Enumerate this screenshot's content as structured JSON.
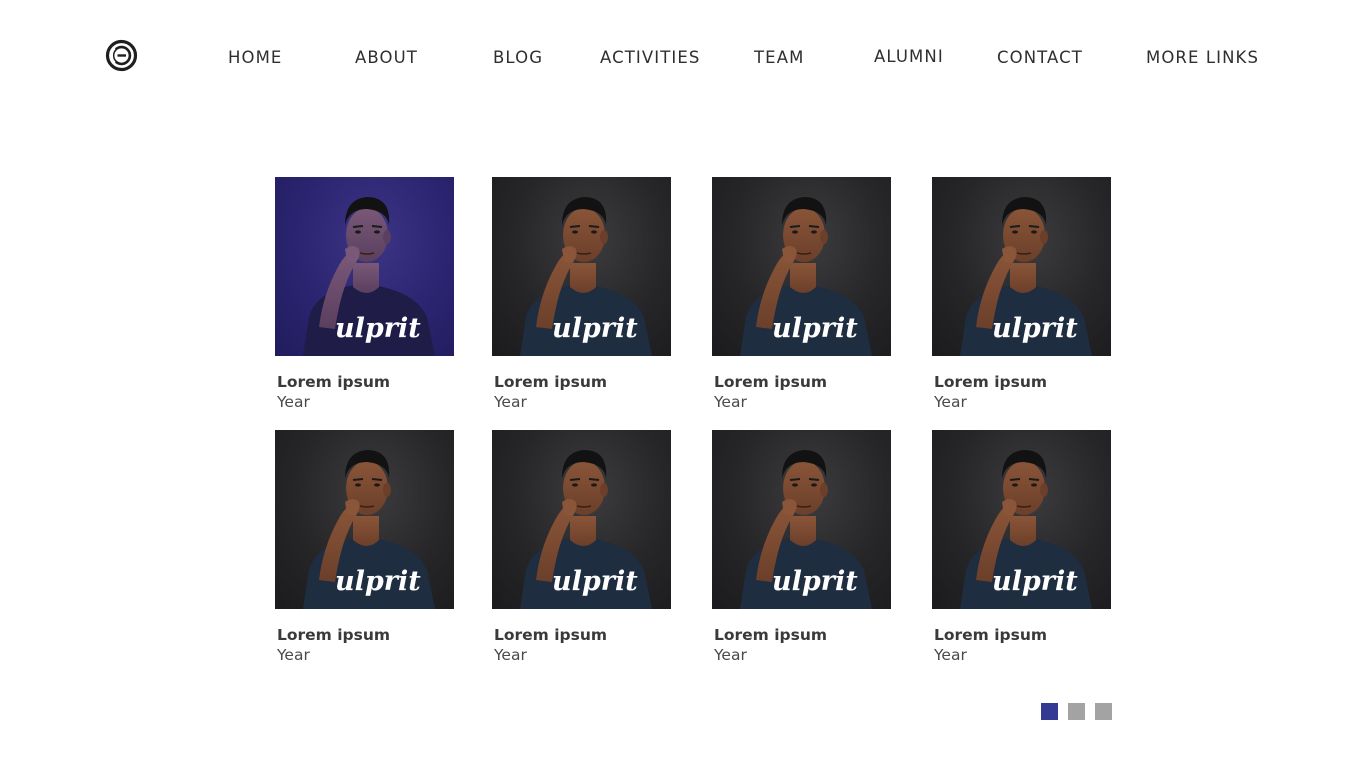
{
  "nav": {
    "logo_icon": "circle-logo-icon",
    "items": [
      {
        "label": "HOME"
      },
      {
        "label": "ABOUT"
      },
      {
        "label": "BLOG"
      },
      {
        "label": "ACTIVITIES"
      },
      {
        "label": "TEAM"
      },
      {
        "label": "ALUMNI"
      },
      {
        "label": "CONTACT"
      },
      {
        "label": "MORE LINKS"
      }
    ]
  },
  "team": {
    "members": [
      {
        "name": "Lorem ipsum",
        "year": "Year",
        "shirt_text": "ulprit",
        "highlighted": true
      },
      {
        "name": "Lorem ipsum",
        "year": "Year",
        "shirt_text": "ulprit",
        "highlighted": false
      },
      {
        "name": "Lorem ipsum",
        "year": "Year",
        "shirt_text": "ulprit",
        "highlighted": false
      },
      {
        "name": "Lorem ipsum",
        "year": "Year",
        "shirt_text": "ulprit",
        "highlighted": false
      },
      {
        "name": "Lorem ipsum",
        "year": "Year",
        "shirt_text": "ulprit",
        "highlighted": false
      },
      {
        "name": "Lorem ipsum",
        "year": "Year",
        "shirt_text": "ulprit",
        "highlighted": false
      },
      {
        "name": "Lorem ipsum",
        "year": "Year",
        "shirt_text": "ulprit",
        "highlighted": false
      },
      {
        "name": "Lorem ipsum",
        "year": "Year",
        "shirt_text": "ulprit",
        "highlighted": false
      }
    ]
  },
  "pagination": {
    "pages": 3,
    "current": 1,
    "active_color": "#343a93",
    "inactive_color": "#a3a3a3"
  },
  "colors": {
    "highlight_overlay": "#2b2470",
    "text": "#333333"
  }
}
